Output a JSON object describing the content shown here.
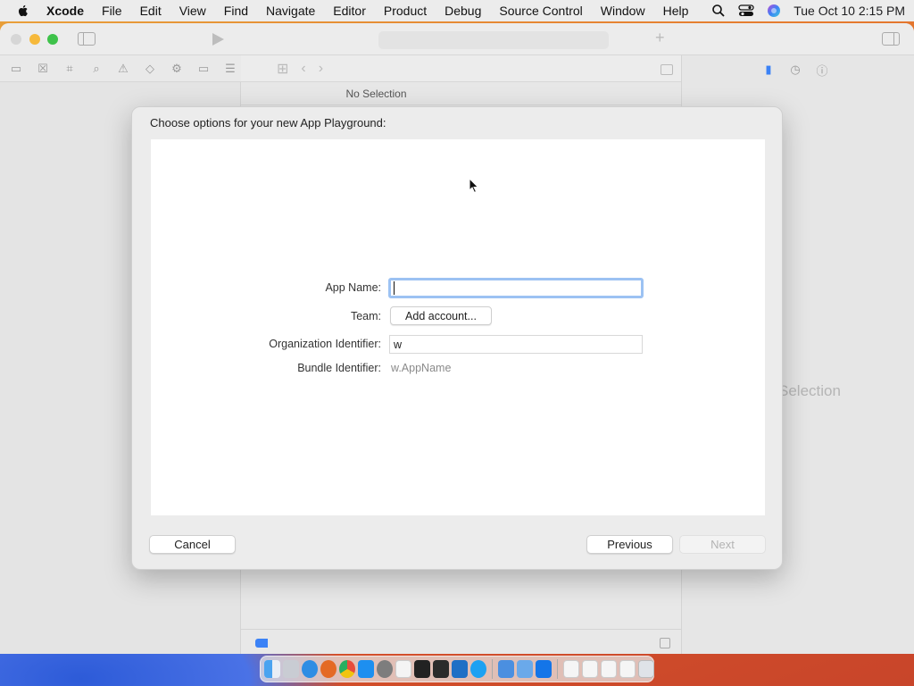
{
  "menubar": {
    "app_name": "Xcode",
    "items": [
      "File",
      "Edit",
      "View",
      "Find",
      "Navigate",
      "Editor",
      "Product",
      "Debug",
      "Source Control",
      "Window",
      "Help"
    ],
    "clock": "Tue Oct 10  2:15 PM"
  },
  "editor": {
    "no_selection": "No Selection"
  },
  "inspector": {
    "no_selection": "Selection"
  },
  "sheet": {
    "title": "Choose options for your new App Playground:",
    "app_name_label": "App Name:",
    "app_name_value": "",
    "team_label": "Team:",
    "team_button": "Add account...",
    "org_label": "Organization Identifier:",
    "org_value": "w",
    "bundle_label": "Bundle Identifier:",
    "bundle_value": "w.AppName",
    "cancel": "Cancel",
    "previous": "Previous",
    "next": "Next"
  },
  "colors": {
    "accent": "#3b82f6",
    "focus_ring": "#9cc2f3"
  },
  "dock": {
    "icons": [
      "finder-icon",
      "launchpad-icon",
      "safari-icon",
      "firefox-icon",
      "chrome-icon",
      "app-store-icon",
      "settings-icon",
      "textedit-icon",
      "terminal-icon",
      "xcode-brush-icon",
      "vscode-icon",
      "skype-icon",
      "preview-icon",
      "mail-icon",
      "xcode-icon",
      "recent-doc-icon",
      "recent-doc-icon",
      "recent-doc-icon",
      "recent-doc-icon",
      "trash-icon"
    ]
  }
}
